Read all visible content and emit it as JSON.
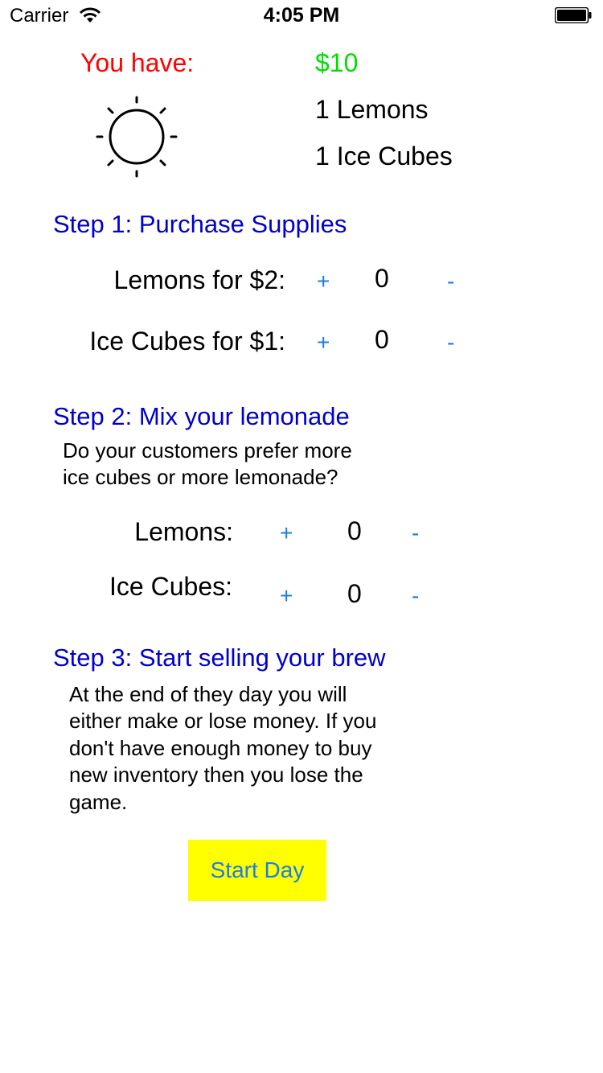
{
  "status_bar": {
    "carrier": "Carrier",
    "time": "4:05 PM"
  },
  "inventory": {
    "label": "You have:",
    "money": "$10",
    "lemons": "1 Lemons",
    "ice_cubes": "1 Ice Cubes",
    "weather_icon": "sun-icon"
  },
  "step1": {
    "title": "Step 1: Purchase Supplies",
    "rows": [
      {
        "label": "Lemons for $2:",
        "plus": "+",
        "value": "0",
        "minus": "-"
      },
      {
        "label": "Ice Cubes for $1:",
        "plus": "+",
        "value": "0",
        "minus": "-"
      }
    ]
  },
  "step2": {
    "title": "Step 2: Mix your lemonade",
    "desc_line1": "Do your customers prefer more",
    "desc_line2": "ice cubes or more lemonade?",
    "rows": [
      {
        "label": "Lemons:",
        "plus": "+",
        "value": "0",
        "minus": "-"
      },
      {
        "label": "Ice Cubes:",
        "plus": "+",
        "value": "0",
        "minus": "-"
      }
    ]
  },
  "step3": {
    "title": "Step 3: Start selling your brew",
    "lines": [
      "At the end of they day you will",
      "either make or lose money. If you",
      "don't have enough money to buy",
      "new inventory then you lose the",
      "game."
    ]
  },
  "start_button": {
    "label": "Start Day"
  },
  "colors": {
    "label_red": "#ff0000",
    "money_green": "#00dd00",
    "heading_blue": "#0000cc",
    "link_blue": "#1a7ee6",
    "button_yellow": "#ffff00"
  }
}
